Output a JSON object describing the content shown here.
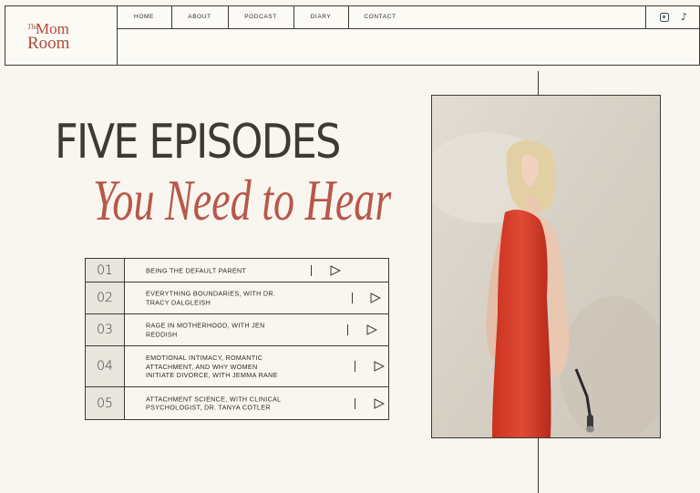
{
  "brand": {
    "the": "The",
    "mom": "Mom",
    "room": "Room"
  },
  "nav": [
    {
      "label": "HOME"
    },
    {
      "label": "ABOUT"
    },
    {
      "label": "PODCAST"
    },
    {
      "label": "DIARY"
    },
    {
      "label": "CONTACT"
    }
  ],
  "social": {
    "instagram": "instagram-icon",
    "tiktok": "tiktok-icon"
  },
  "heading": {
    "line1": "FIVE EPISODES",
    "line2": "You Need to Hear"
  },
  "episodes": [
    {
      "num": "01",
      "title_lines": [
        "BEING THE DEFAULT PARENT"
      ]
    },
    {
      "num": "02",
      "title_lines": [
        "EVERYTHING BOUNDARIES, WITH DR.",
        "TRACY DALGLEISH"
      ]
    },
    {
      "num": "03",
      "title_lines": [
        "RAGE IN MOTHERHOOD, WITH JEN",
        "REDDISH"
      ]
    },
    {
      "num": "04",
      "title_lines": [
        "EMOTIONAL INTIMACY, ROMANTIC",
        "ATTACHMENT, AND WHY WOMEN",
        "INITIATE DIVORCE, WITH JEMMA RANE"
      ]
    },
    {
      "num": "05",
      "title_lines": [
        "ATTACHMENT SCIENCE, WITH CLINICAL",
        "PSYCHOLOGIST, DR. TANYA COTLER"
      ]
    }
  ],
  "colors": {
    "accent": "#b8574b",
    "background": "#f8f6ee",
    "ink": "#3d3a36",
    "number_cell": "#e7e6dc",
    "dress": "#d93a2b"
  }
}
